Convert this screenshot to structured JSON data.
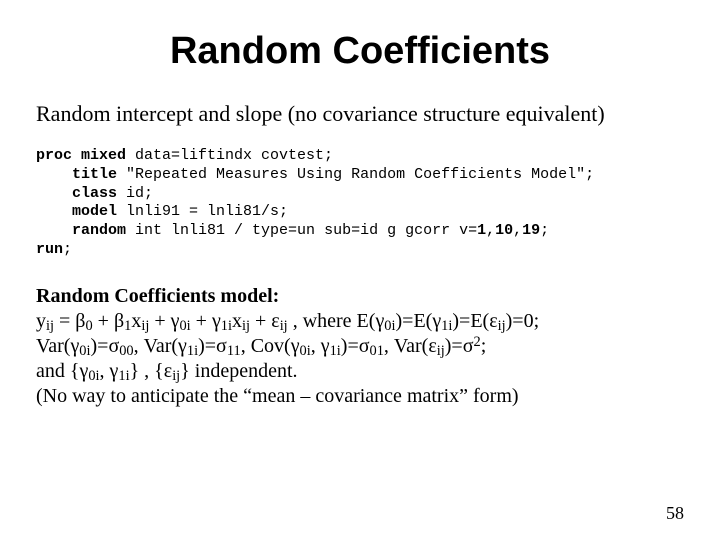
{
  "title": "Random Coefficients",
  "subtitle": "Random intercept and slope (no covariance structure equivalent)",
  "code": {
    "kw_proc_mixed": "proc mixed",
    "proc_rest": " data=liftindx covtest;",
    "kw_title": "title",
    "title_rest": " \"Repeated Measures Using Random Coefficients Model\";",
    "kw_class": "class",
    "class_rest": " id;",
    "kw_model": "model",
    "model_rest": " lnli91 = lnli81/s;",
    "kw_random": "random",
    "random_rest_a": " int lnli81 / type=un sub=id g gcorr v=",
    "v1": "1",
    "comma1": ",",
    "v2": "10",
    "comma2": ",",
    "v3": "19",
    "random_rest_b": ";",
    "kw_run": "run",
    "run_rest": ";"
  },
  "model": {
    "heading": "Random Coefficients model:",
    "eq_y": "y",
    "sub_ij": "ij",
    "eq_eq": " = ",
    "beta": "β",
    "sub_0": "0",
    "plus": " + ",
    "sub_1": "1",
    "x": "x",
    "gamma": "γ",
    "sub_0i": "0i",
    "sub_1i": "1i",
    "eps": "ε",
    "comma_sp": " ,  ",
    "where": "where ",
    "E_open": "E(",
    "close": ")",
    "eq0_semi": "=0;",
    "eq_sign": "=",
    "Var_open": "Var(",
    "sigma": "σ",
    "sub_00": "00",
    "csep": ", ",
    "sub_11": "11",
    "Cov_open": "Cov(",
    "sub_01": "01",
    "sup_2": "2",
    "semi": ";",
    "and_open": "and {",
    "comma": ", ",
    "brace_comma": "} , {",
    "brace_close": "} ",
    "indep": "independent.",
    "noway": "(No way to anticipate the “mean – covariance matrix” form)"
  },
  "page_number": "58"
}
